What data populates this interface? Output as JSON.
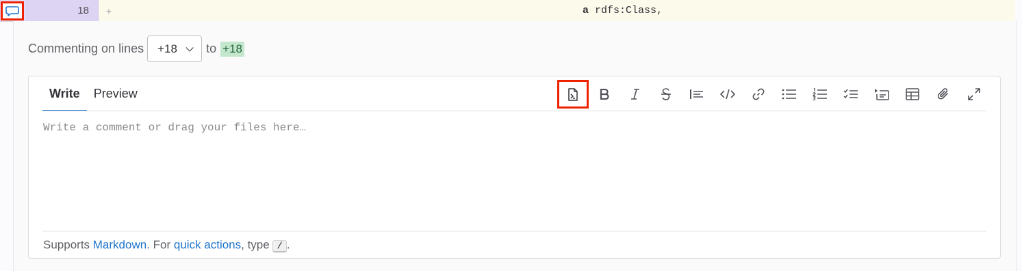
{
  "diff": {
    "new_line_number": "18",
    "sign": "+",
    "code_keyword": "a",
    "code_rest": " rdfs:Class,"
  },
  "comment_form": {
    "commenting_on_label": "Commenting on lines",
    "start_line": "+18",
    "to_label": "to",
    "end_line": "+18"
  },
  "editor": {
    "tabs": [
      {
        "label": "Write",
        "active": true
      },
      {
        "label": "Preview",
        "active": false
      }
    ],
    "toolbar": [
      {
        "name": "insert-suggestion-icon"
      },
      {
        "name": "bold-icon"
      },
      {
        "name": "italic-icon"
      },
      {
        "name": "strikethrough-icon"
      },
      {
        "name": "quote-icon"
      },
      {
        "name": "code-icon"
      },
      {
        "name": "link-icon"
      },
      {
        "name": "bullet-list-icon"
      },
      {
        "name": "numbered-list-icon"
      },
      {
        "name": "task-list-icon"
      },
      {
        "name": "collapsible-section-icon"
      },
      {
        "name": "table-icon"
      },
      {
        "name": "attach-file-icon"
      },
      {
        "name": "fullscreen-icon"
      }
    ],
    "placeholder": "Write a comment or drag your files here…",
    "footer": {
      "supports": "Supports ",
      "markdown_link": "Markdown",
      "for_text": ". For ",
      "quick_actions_link": "quick actions",
      "type_text": ", type ",
      "slash": "/",
      "end": "."
    }
  },
  "colors": {
    "link": "#1f75cb",
    "highlight_box": "#ee2200",
    "added_badge_bg": "#c3e6cd"
  }
}
